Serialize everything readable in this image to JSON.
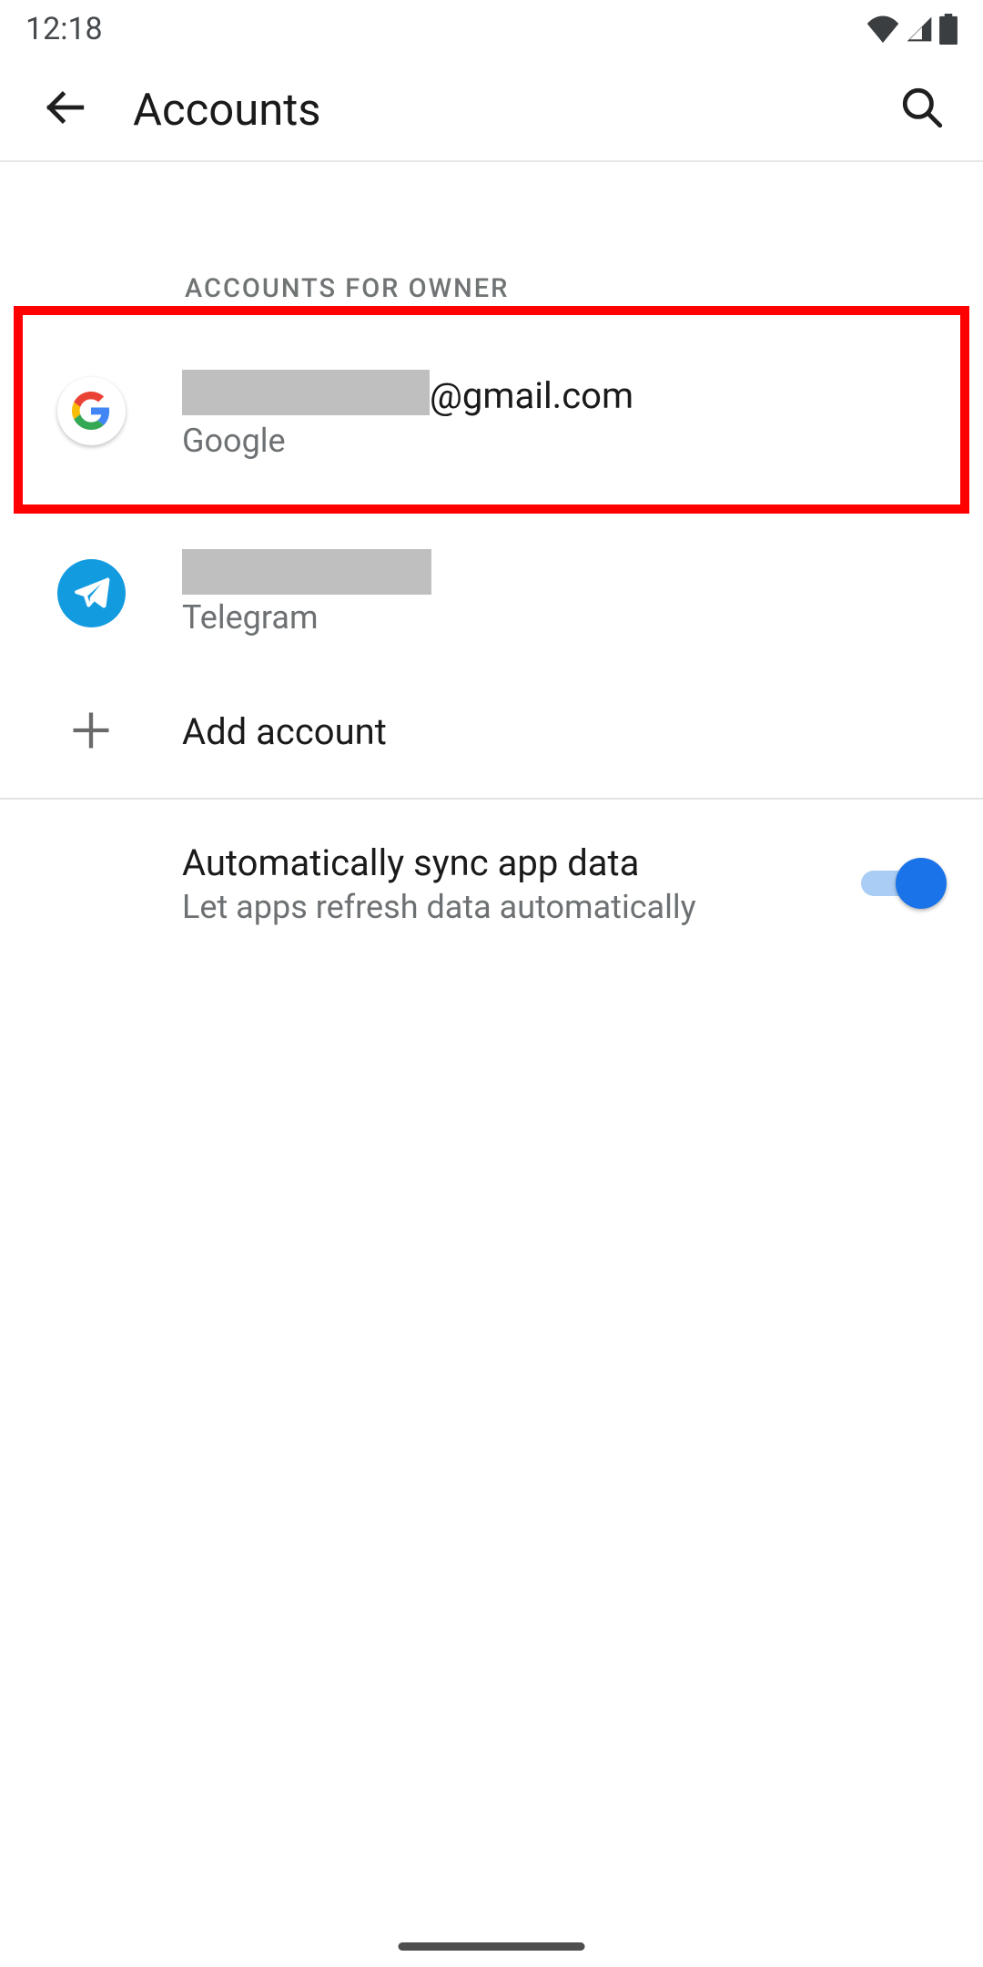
{
  "status": {
    "time": "12:18"
  },
  "appbar": {
    "title": "Accounts"
  },
  "section_label": "ACCOUNTS FOR OWNER",
  "accounts": {
    "google": {
      "email_suffix": "@gmail.com",
      "provider": "Google"
    },
    "telegram": {
      "provider": "Telegram"
    }
  },
  "add_account_label": "Add account",
  "sync": {
    "title": "Automatically sync app data",
    "subtitle": "Let apps refresh data automatically",
    "enabled": true
  },
  "colors": {
    "highlight": "#ff0000",
    "telegram": "#139be0",
    "switch_thumb": "#1a73e8",
    "switch_track": "#a9cdf4"
  }
}
